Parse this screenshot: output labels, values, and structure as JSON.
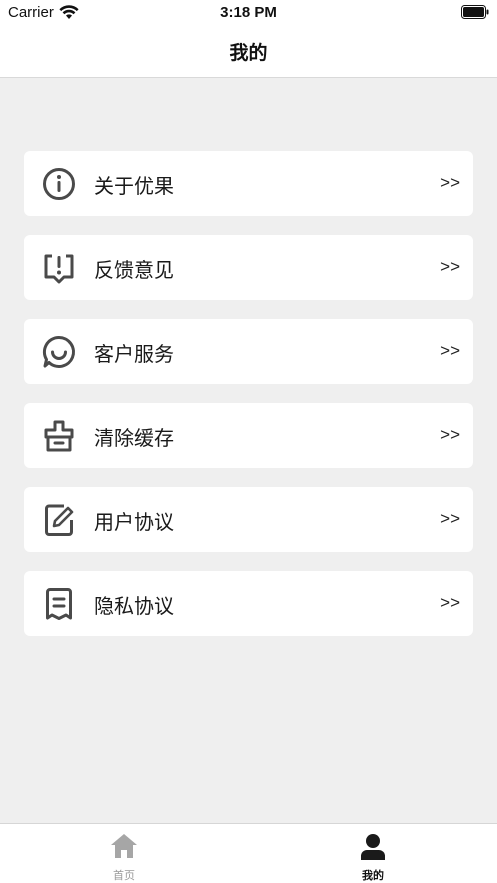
{
  "status_bar": {
    "carrier": "Carrier",
    "time": "3:18 PM"
  },
  "nav": {
    "title": "我的"
  },
  "menu": {
    "items": [
      {
        "label": "关于优果",
        "arrow": ">>",
        "icon": "info-icon"
      },
      {
        "label": "反馈意见",
        "arrow": ">>",
        "icon": "feedback-icon"
      },
      {
        "label": "客户服务",
        "arrow": ">>",
        "icon": "chat-icon"
      },
      {
        "label": "清除缓存",
        "arrow": ">>",
        "icon": "broom-icon"
      },
      {
        "label": "用户协议",
        "arrow": ">>",
        "icon": "edit-document-icon"
      },
      {
        "label": "隐私协议",
        "arrow": ">>",
        "icon": "document-icon"
      }
    ]
  },
  "tab_bar": {
    "tabs": [
      {
        "label": "首页",
        "icon": "home-icon",
        "active": false
      },
      {
        "label": "我的",
        "icon": "person-icon",
        "active": true
      }
    ]
  },
  "colors": {
    "background": "#efefef",
    "card": "#ffffff",
    "icon": "#4a4a4a",
    "tab_inactive": "#9a9a9a",
    "tab_active": "#111111"
  }
}
